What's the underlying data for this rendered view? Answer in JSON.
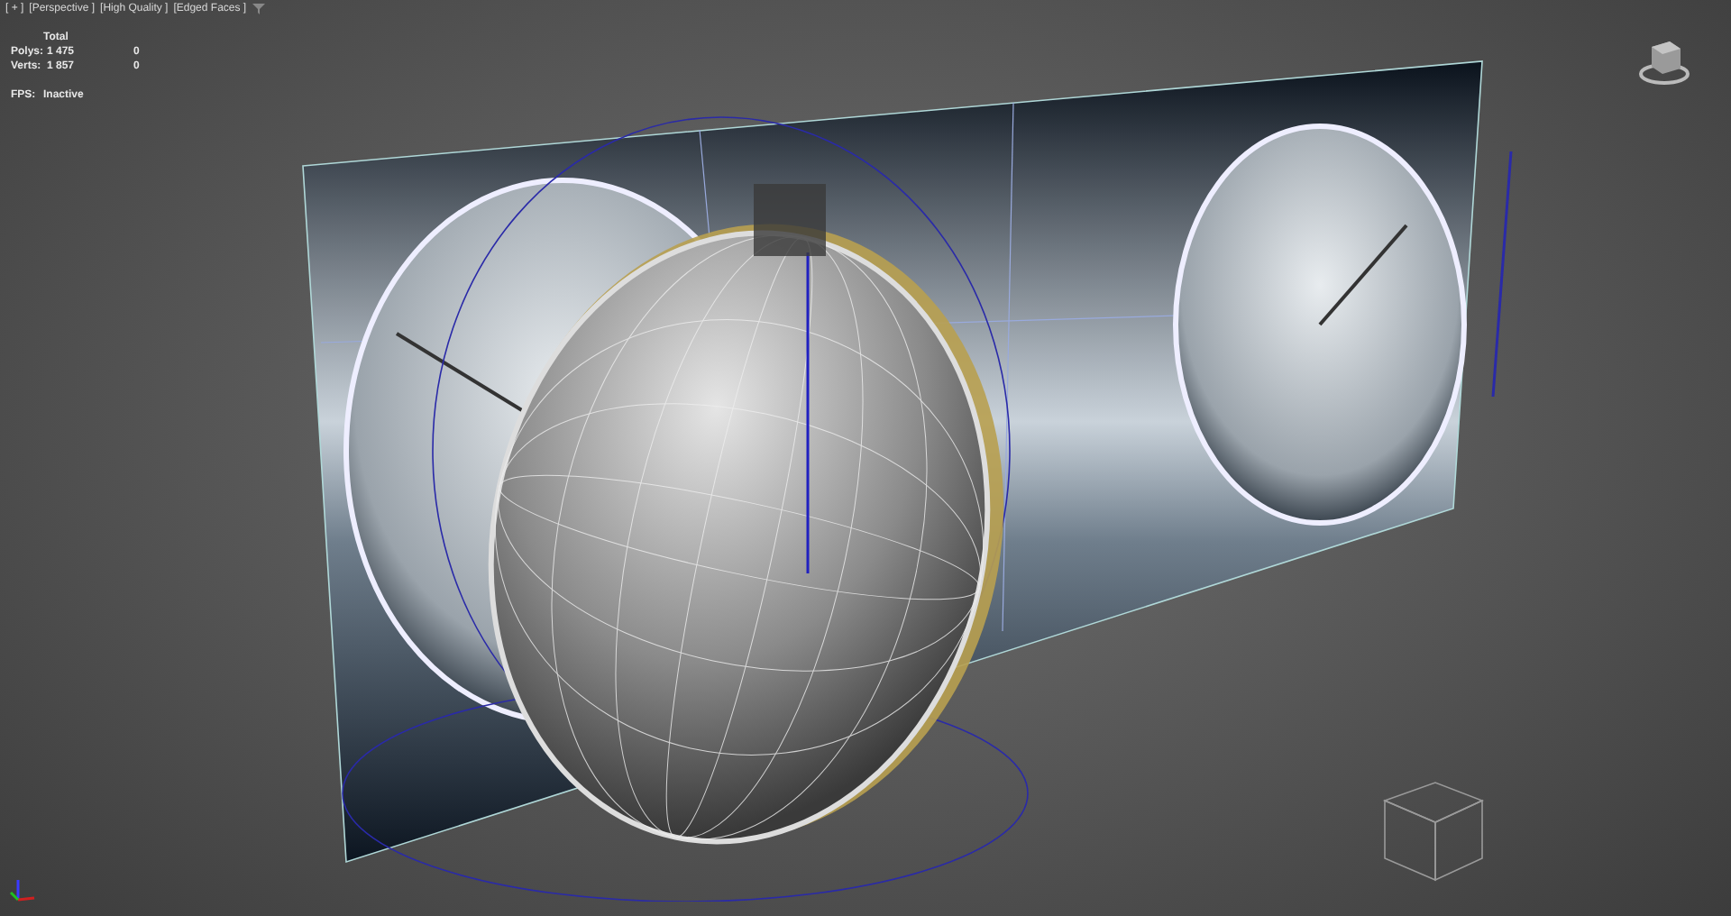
{
  "viewport_labels": [
    {
      "text": "[ + ]"
    },
    {
      "text": "[Perspective ]"
    },
    {
      "text": "[High Quality ]"
    },
    {
      "text": "[Edged Faces ]"
    }
  ],
  "stats": {
    "header": "Total",
    "rows": [
      {
        "label": "Polys:",
        "column_1": "1 475",
        "column_2": "0"
      },
      {
        "label": "Verts:",
        "column_1": "1 857",
        "column_2": "0"
      }
    ]
  },
  "fps": {
    "label": "FPS:",
    "value": "Inactive"
  }
}
